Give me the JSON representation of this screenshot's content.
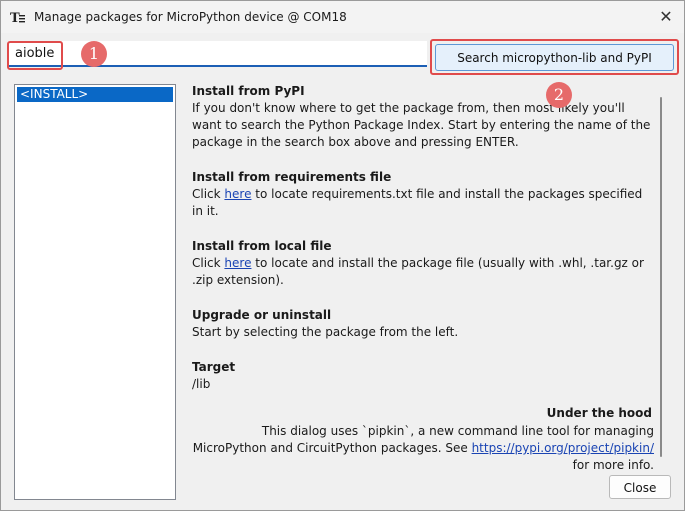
{
  "window": {
    "title": "Manage packages for MicroPython device @ COM18",
    "close_glyph": "✕"
  },
  "search": {
    "value": "aioble",
    "button_label": "Search micropython-lib and PyPI"
  },
  "annotations": {
    "badge1": "1",
    "badge2": "2",
    "color": "#e04b4b"
  },
  "package_list": {
    "items": [
      {
        "label": "<INSTALL>",
        "selected": true
      }
    ]
  },
  "info": {
    "pypi": {
      "heading": "Install from PyPI",
      "text": "If you don't know where to get the package from, then most likely you'll want to search the Python Package Index. Start by entering the name of the package in the search box above and pressing ENTER."
    },
    "requirements": {
      "heading": "Install from requirements file",
      "pre": "Click ",
      "link": "here",
      "post": " to locate requirements.txt file and install the packages specified in it."
    },
    "local": {
      "heading": "Install from local file",
      "pre": "Click ",
      "link": "here",
      "post": " to locate and install the package file (usually with .whl, .tar.gz or .zip extension)."
    },
    "upgrade": {
      "heading": "Upgrade or uninstall",
      "text": "Start by selecting the package from the left."
    },
    "target": {
      "heading": "Target",
      "text": "/lib"
    },
    "hood": {
      "heading": "Under the hood",
      "pre": "This dialog uses `pipkin`, a new command line tool for managing MicroPython and CircuitPython packages. See ",
      "link": "https://pypi.org/project/pipkin/",
      "post": " for more info."
    }
  },
  "footer": {
    "close_label": "Close"
  },
  "colors": {
    "accent": "#1c5fb5",
    "selection": "#0a68c6",
    "link": "#1a44b3",
    "annotation": "#e66a6a"
  }
}
